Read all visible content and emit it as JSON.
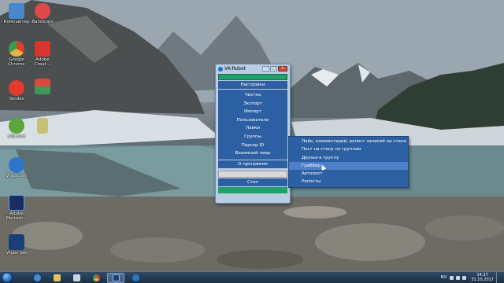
{
  "desktop_icons": [
    {
      "name": "computer-icon",
      "label": "Компьютер",
      "color": "#4a87c9"
    },
    {
      "name": "bandicam-icon",
      "label": "Bandicam",
      "color": "#e04848"
    },
    {
      "name": "chrome-icon",
      "label": "Google Chrome",
      "color": "#e8b23b"
    },
    {
      "name": "adobe-creative-cloud-icon",
      "label": "Adobe Creat...",
      "color": "#d9352e"
    },
    {
      "name": "yandex-icon",
      "label": "Yandex",
      "color": "#e33c2e"
    },
    {
      "name": "app-icon-2",
      "label": "",
      "color": "#3f9a5a"
    },
    {
      "name": "utorrent-icon",
      "label": "uTorrent",
      "color": "#5aa53c"
    },
    {
      "name": "file-icon",
      "label": "",
      "color": "#c7c07a"
    },
    {
      "name": "vtope-bot-icon",
      "label": "Vtope bot",
      "color": "#2b76c7"
    },
    {
      "name": "photoshop-icon",
      "label": "Adobe Photosh...",
      "color": "#1a2d5c"
    },
    {
      "name": "vkrobot-desktop-icon",
      "label": "Vtope bot",
      "color": "#1a3e78"
    }
  ],
  "window": {
    "title": "VK-Robot",
    "buttons": {
      "minimize": "–",
      "maximize": "□",
      "close": "✕"
    },
    "settings": "Настройки",
    "menu": [
      "Чистка",
      "Экспорт",
      "Импорт",
      "Пользователи",
      "Лайки",
      "Группы",
      "Парсер ID",
      "Взаимный пиар"
    ],
    "about": "О программе",
    "stop": "Стоп"
  },
  "submenu": {
    "items": [
      "Лайк, комментарий, репост записей на стене",
      "Пост на стену по группам",
      "Друзья в группу",
      "Граббер",
      "Автопост",
      "Репосты"
    ],
    "active_index": 3
  },
  "taskbar": {
    "items": [
      {
        "name": "ie-taskbar-icon",
        "color": "#3d8fe0"
      },
      {
        "name": "explorer-taskbar-icon",
        "color": "#e8c35a"
      },
      {
        "name": "media-taskbar-icon",
        "color": "#c9d3dd"
      },
      {
        "name": "chrome-taskbar-icon",
        "color": "#e8b23b"
      },
      {
        "name": "vkrobot-taskbar-icon",
        "color": "#1a3e78"
      },
      {
        "name": "vtope-taskbar-icon",
        "color": "#2b76c7"
      }
    ],
    "language": "RU",
    "time": "14:27",
    "date": "31.10.2017"
  }
}
